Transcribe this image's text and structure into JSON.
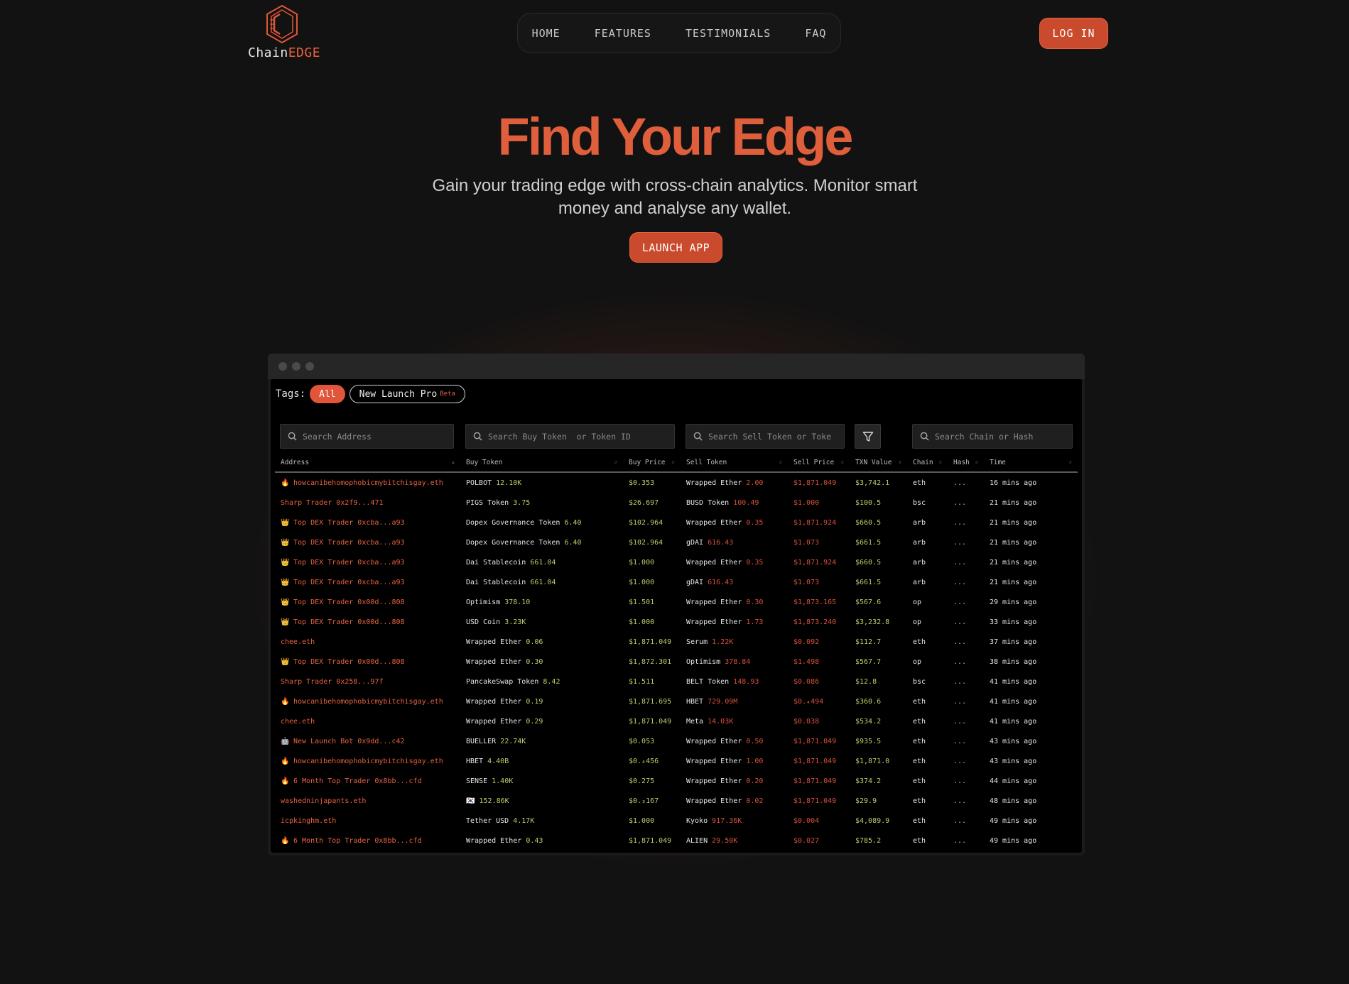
{
  "brand": {
    "name_part1": "Chain",
    "name_part2": "EDGE"
  },
  "nav": {
    "items": [
      "HOME",
      "FEATURES",
      "TESTIMONIALS",
      "FAQ"
    ]
  },
  "header": {
    "login_label": "LOG IN"
  },
  "hero": {
    "title": "Find Your Edge",
    "subtitle": "Gain your trading edge with cross-chain analytics. Monitor smart money and analyse any wallet.",
    "cta_label": "LAUNCH APP"
  },
  "colors": {
    "accent": "#e1563a",
    "green": "#b6cf6a",
    "red": "#d8503a",
    "background": "#121212"
  },
  "app": {
    "tags_label": "Tags:",
    "tags": [
      {
        "label": "All",
        "active": true
      },
      {
        "label": "New Launch Pro",
        "badge": "Beta",
        "active": false
      }
    ],
    "search": {
      "address": "Search Address",
      "buy_token": "Search Buy Token  or Token ID",
      "sell_token": "Search Sell Token or Toke",
      "chain_hash": "Search Chain or Hash"
    },
    "columns": [
      "Address",
      "Buy Token",
      "Buy Price",
      "Sell Token",
      "Sell Price",
      "TXN Value",
      "Chain",
      "Hash",
      "Time"
    ],
    "rows": [
      {
        "icon": "fire",
        "address": "howcanibehomophobicmybitchisgay.eth",
        "buy_name": "POLBOT",
        "buy_amt": "12.10K",
        "buy_price": "$0.353",
        "sell_name": "Wrapped Ether",
        "sell_amt": "2.00",
        "sell_price": "$1,871.049",
        "value": "$3,742.1",
        "chain": "eth",
        "hash": "...",
        "time": "16 mins ago"
      },
      {
        "icon": "",
        "address": "Sharp Trader 0x2f9...471",
        "buy_name": "PIGS Token",
        "buy_amt": "3.75",
        "buy_price": "$26.697",
        "sell_name": "BUSD Token",
        "sell_amt": "100.49",
        "sell_price": "$1.000",
        "value": "$100.5",
        "chain": "bsc",
        "hash": "...",
        "time": "21 mins ago"
      },
      {
        "icon": "crown",
        "address": "Top DEX Trader 0xcba...a93",
        "buy_name": "Dopex Governance Token",
        "buy_amt": "6.40",
        "buy_price": "$102.964",
        "sell_name": "Wrapped Ether",
        "sell_amt": "0.35",
        "sell_price": "$1,871.924",
        "value": "$660.5",
        "chain": "arb",
        "hash": "...",
        "time": "21 mins ago"
      },
      {
        "icon": "crown",
        "address": "Top DEX Trader 0xcba...a93",
        "buy_name": "Dopex Governance Token",
        "buy_amt": "6.40",
        "buy_price": "$102.964",
        "sell_name": "gDAI",
        "sell_amt": "616.43",
        "sell_price": "$1.073",
        "value": "$661.5",
        "chain": "arb",
        "hash": "...",
        "time": "21 mins ago"
      },
      {
        "icon": "crown",
        "address": "Top DEX Trader 0xcba...a93",
        "buy_name": "Dai Stablecoin",
        "buy_amt": "661.04",
        "buy_price": "$1.000",
        "sell_name": "Wrapped Ether",
        "sell_amt": "0.35",
        "sell_price": "$1,871.924",
        "value": "$660.5",
        "chain": "arb",
        "hash": "...",
        "time": "21 mins ago"
      },
      {
        "icon": "crown",
        "address": "Top DEX Trader 0xcba...a93",
        "buy_name": "Dai Stablecoin",
        "buy_amt": "661.04",
        "buy_price": "$1.000",
        "sell_name": "gDAI",
        "sell_amt": "616.43",
        "sell_price": "$1.073",
        "value": "$661.5",
        "chain": "arb",
        "hash": "...",
        "time": "21 mins ago"
      },
      {
        "icon": "crown",
        "address": "Top DEX Trader 0x00d...808",
        "buy_name": "Optimism",
        "buy_amt": "378.10",
        "buy_price": "$1.501",
        "sell_name": "Wrapped Ether",
        "sell_amt": "0.30",
        "sell_price": "$1,873.165",
        "value": "$567.6",
        "chain": "op",
        "hash": "...",
        "time": "29 mins ago"
      },
      {
        "icon": "crown",
        "address": "Top DEX Trader 0x00d...808",
        "buy_name": "USD Coin",
        "buy_amt": "3.23K",
        "buy_price": "$1.000",
        "sell_name": "Wrapped Ether",
        "sell_amt": "1.73",
        "sell_price": "$1,873.240",
        "value": "$3,232.8",
        "chain": "op",
        "hash": "...",
        "time": "33 mins ago"
      },
      {
        "icon": "",
        "address": "chee.eth",
        "buy_name": "Wrapped Ether",
        "buy_amt": "0.06",
        "buy_price": "$1,871.049",
        "sell_name": "Serum",
        "sell_amt": "1.22K",
        "sell_price": "$0.092",
        "value": "$112.7",
        "chain": "eth",
        "hash": "...",
        "time": "37 mins ago"
      },
      {
        "icon": "crown",
        "address": "Top DEX Trader 0x00d...808",
        "buy_name": "Wrapped Ether",
        "buy_amt": "0.30",
        "buy_price": "$1,872.301",
        "sell_name": "Optimism",
        "sell_amt": "378.84",
        "sell_price": "$1.498",
        "value": "$567.7",
        "chain": "op",
        "hash": "...",
        "time": "38 mins ago"
      },
      {
        "icon": "",
        "address": "Sharp Trader 0x258...97f",
        "buy_name": "PancakeSwap Token",
        "buy_amt": "8.42",
        "buy_price": "$1.511",
        "sell_name": "BELT Token",
        "sell_amt": "148.93",
        "sell_price": "$0.086",
        "value": "$12.8",
        "chain": "bsc",
        "hash": "...",
        "time": "41 mins ago"
      },
      {
        "icon": "fire",
        "address": "howcanibehomophobicmybitchisgay.eth",
        "buy_name": "Wrapped Ether",
        "buy_amt": "0.19",
        "buy_price": "$1,871.695",
        "sell_name": "HBET",
        "sell_amt": "729.09M",
        "sell_price": "$0.₄494",
        "value": "$360.6",
        "chain": "eth",
        "hash": "...",
        "time": "41 mins ago"
      },
      {
        "icon": "",
        "address": "chee.eth",
        "buy_name": "Wrapped Ether",
        "buy_amt": "0.29",
        "buy_price": "$1,871.049",
        "sell_name": "Meta",
        "sell_amt": "14.03K",
        "sell_price": "$0.038",
        "value": "$534.2",
        "chain": "eth",
        "hash": "...",
        "time": "41 mins ago"
      },
      {
        "icon": "bot",
        "address": "New Launch Bot 0x9dd...c42",
        "buy_name": "BUELLER",
        "buy_amt": "22.74K",
        "buy_price": "$0.053",
        "sell_name": "Wrapped Ether",
        "sell_amt": "0.50",
        "sell_price": "$1,871.049",
        "value": "$935.5",
        "chain": "eth",
        "hash": "...",
        "time": "43 mins ago"
      },
      {
        "icon": "fire",
        "address": "howcanibehomophobicmybitchisgay.eth",
        "buy_name": "HBET",
        "buy_amt": "4.40B",
        "buy_price": "$0.₄456",
        "sell_name": "Wrapped Ether",
        "sell_amt": "1.00",
        "sell_price": "$1,871.049",
        "value": "$1,871.0",
        "chain": "eth",
        "hash": "...",
        "time": "43 mins ago"
      },
      {
        "icon": "fire",
        "address": "6 Month Top Trader 0x8bb...cfd",
        "buy_name": "SENSE",
        "buy_amt": "1.40K",
        "buy_price": "$0.275",
        "sell_name": "Wrapped Ether",
        "sell_amt": "0.20",
        "sell_price": "$1,871.049",
        "value": "$374.2",
        "chain": "eth",
        "hash": "...",
        "time": "44 mins ago"
      },
      {
        "icon": "",
        "address": "washedninjapants.eth",
        "buy_name": "🇰🇷",
        "buy_amt": "152.86K",
        "buy_price": "$0.₃167",
        "sell_name": "Wrapped Ether",
        "sell_amt": "0.02",
        "sell_price": "$1,871.049",
        "value": "$29.9",
        "chain": "eth",
        "hash": "...",
        "time": "48 mins ago"
      },
      {
        "icon": "",
        "address": "icpkinghm.eth",
        "buy_name": "Tether USD",
        "buy_amt": "4.17K",
        "buy_price": "$1.000",
        "sell_name": "Kyoko",
        "sell_amt": "917.36K",
        "sell_price": "$0.004",
        "value": "$4,089.9",
        "chain": "eth",
        "hash": "...",
        "time": "49 mins ago"
      },
      {
        "icon": "fire",
        "address": "6 Month Top Trader 0x8bb...cfd",
        "buy_name": "Wrapped Ether",
        "buy_amt": "0.43",
        "buy_price": "$1,871.049",
        "sell_name": "ALIEN",
        "sell_amt": "29.50K",
        "sell_price": "$0.027",
        "value": "$785.2",
        "chain": "eth",
        "hash": "...",
        "time": "49 mins ago"
      }
    ]
  }
}
